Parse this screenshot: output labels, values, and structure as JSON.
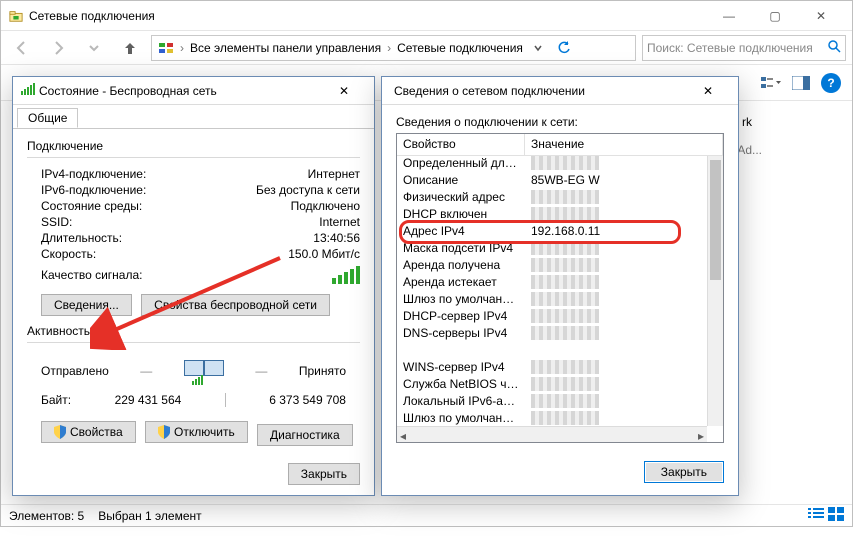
{
  "explorer": {
    "title": "Сетевые подключения",
    "breadcrumb": {
      "root_aria": "Все элементы панели управления",
      "item1": "Все элементы панели управления",
      "item2": "Сетевые подключения"
    },
    "search_placeholder": "Поиск: Сетевые подключения",
    "pane_item_label_suffix": "rk",
    "pane_item_sub_suffix": "et Ad...",
    "status_bar_items": "Элементов: 5",
    "status_bar_selected": "Выбран 1 элемент"
  },
  "status": {
    "title": "Состояние - Беспроводная сеть",
    "tab_general": "Общие",
    "grp_conn": "Подключение",
    "kv": {
      "ipv4_label": "IPv4-подключение:",
      "ipv4_value": "Интернет",
      "ipv6_label": "IPv6-подключение:",
      "ipv6_value": "Без доступа к сети",
      "media_label": "Состояние среды:",
      "media_value": "Подключено",
      "ssid_label": "SSID:",
      "ssid_value": "Internet",
      "dur_label": "Длительность:",
      "dur_value": "13:40:56",
      "speed_label": "Скорость:",
      "speed_value": "150.0 Мбит/с",
      "signal_label": "Качество сигнала:"
    },
    "btn_details": "Сведения...",
    "btn_wlan_props": "Свойства беспроводной сети",
    "grp_activity": "Активность",
    "sent_label": "Отправлено",
    "recv_label": "Принято",
    "bytes_label": "Байт:",
    "bytes_sent": "229 431 564",
    "bytes_recv": "6 373 549 708",
    "btn_props": "Свойства",
    "btn_disable": "Отключить",
    "btn_diag": "Диагностика",
    "btn_close": "Закрыть"
  },
  "details": {
    "title": "Сведения о сетевом подключении",
    "label": "Сведения о подключении к сети:",
    "col_prop": "Свойство",
    "col_val": "Значение",
    "rows": [
      {
        "p": "Определенный для по...",
        "v": ""
      },
      {
        "p": "Описание",
        "v": "85WB-EG W"
      },
      {
        "p": "Физический адрес",
        "v": ""
      },
      {
        "p": "DHCP включен",
        "v": ""
      },
      {
        "p": "Адрес IPv4",
        "v": "192.168.0.11"
      },
      {
        "p": "Маска подсети IPv4",
        "v": ""
      },
      {
        "p": "Аренда получена",
        "v": ""
      },
      {
        "p": "Аренда истекает",
        "v": ""
      },
      {
        "p": "Шлюз по умолчанию IP...",
        "v": ""
      },
      {
        "p": "DHCP-сервер IPv4",
        "v": ""
      },
      {
        "p": "DNS-серверы IPv4",
        "v": ""
      },
      {
        "p": "",
        "v": ""
      },
      {
        "p": "WINS-сервер IPv4",
        "v": ""
      },
      {
        "p": "Служба NetBIOS через...",
        "v": ""
      },
      {
        "p": "Локальный IPv6-адрес...",
        "v": ""
      },
      {
        "p": "Шлюз по умолчанию IP...",
        "v": ""
      }
    ],
    "btn_close": "Закрыть"
  }
}
